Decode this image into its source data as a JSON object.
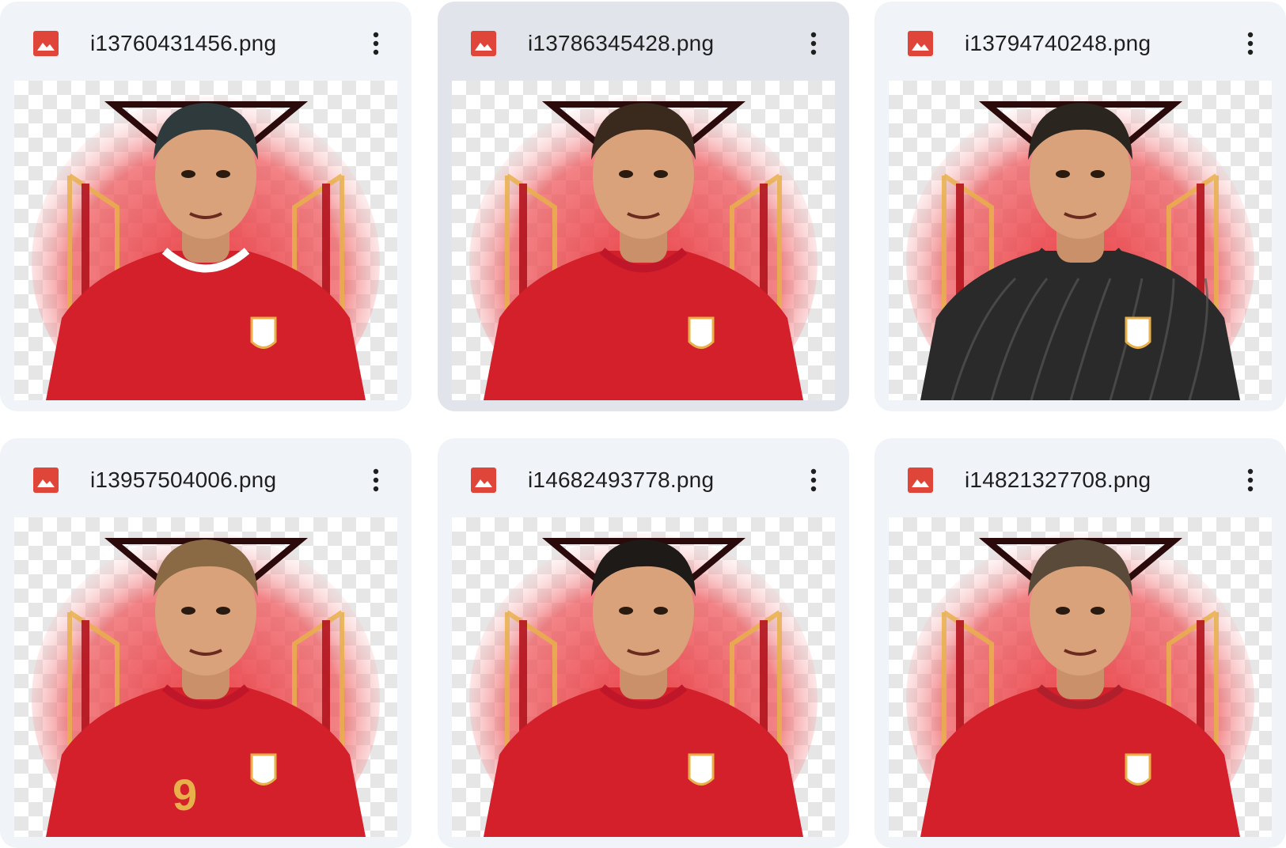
{
  "files": [
    {
      "name": "i13760431456.png",
      "selected": false,
      "kit": "red",
      "hair": "#2f3a3c",
      "accent": "#ffffff",
      "number": ""
    },
    {
      "name": "i13786345428.png",
      "selected": true,
      "kit": "red",
      "hair": "#3a2a1e",
      "accent": "#c0162a",
      "number": ""
    },
    {
      "name": "i13794740248.png",
      "selected": false,
      "kit": "dark",
      "hair": "#2b2520",
      "accent": "#2a2a2a",
      "number": ""
    },
    {
      "name": "i13957504006.png",
      "selected": false,
      "kit": "red",
      "hair": "#8a6a44",
      "accent": "#c0162a",
      "number": "9"
    },
    {
      "name": "i14682493778.png",
      "selected": false,
      "kit": "red",
      "hair": "#1e1a17",
      "accent": "#c0162a",
      "number": ""
    },
    {
      "name": "i14821327708.png",
      "selected": false,
      "kit": "red",
      "hair": "#5a4a3a",
      "accent": "#b0202c",
      "number": ""
    }
  ],
  "icons": {
    "file_type": "image-file-icon",
    "menu": "more-vert-icon"
  },
  "colors": {
    "card_bg": "#f0f3f8",
    "card_selected_bg": "#e1e4ea",
    "image_icon": "#e0453a",
    "text": "#1f1f1f",
    "shirt_red": "#d3202a",
    "crest_gold": "#e8b04a",
    "dark_kit": "#2a2a2a"
  }
}
